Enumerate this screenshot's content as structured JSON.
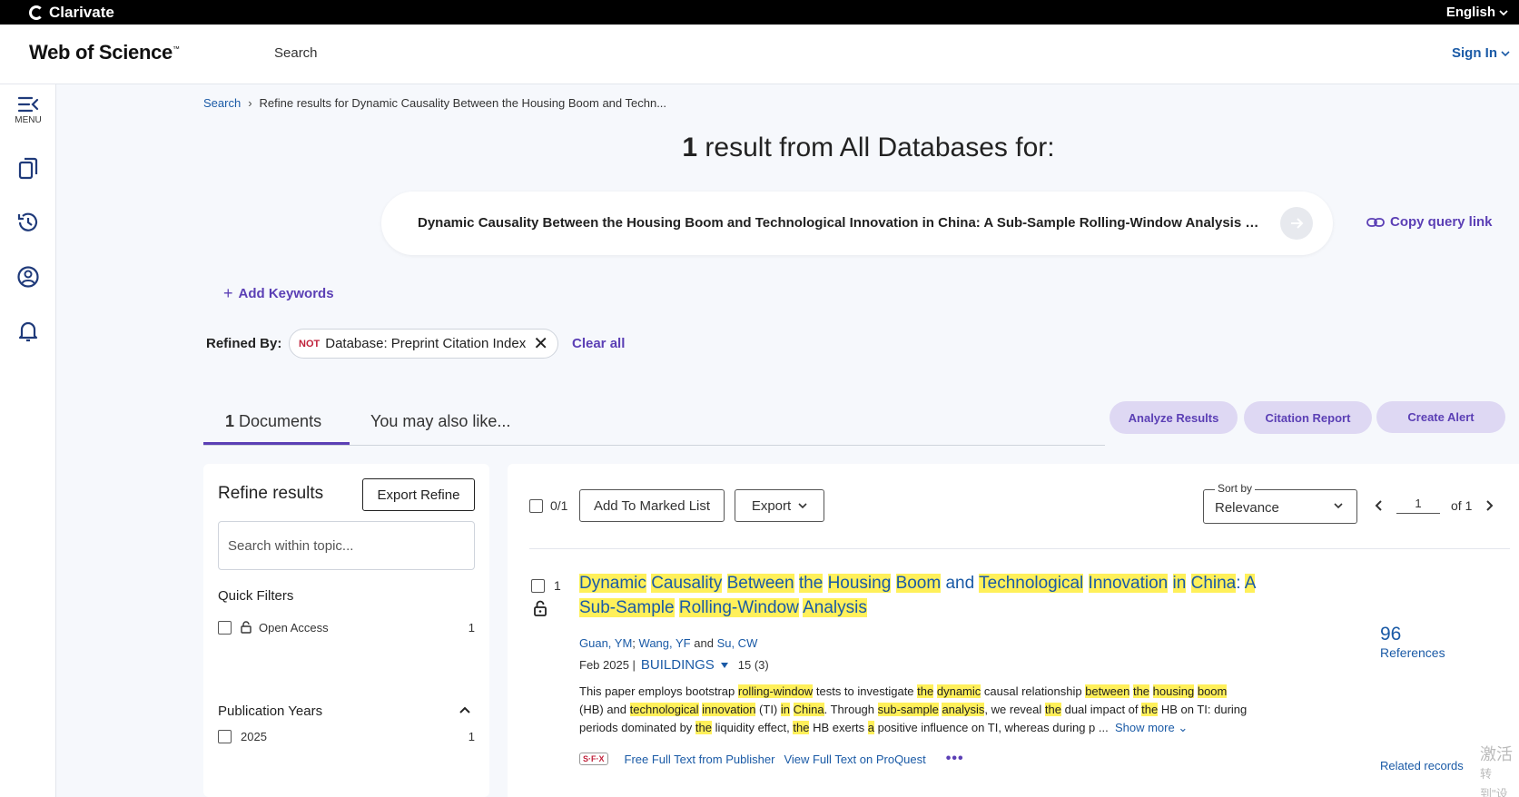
{
  "topbar": {
    "brand": "Clarivate",
    "language": "English"
  },
  "header": {
    "product": "Web of Science",
    "trademark": "™",
    "nav_search": "Search",
    "sign_in": "Sign In"
  },
  "rail": {
    "menu_label": "MENU"
  },
  "breadcrumb": {
    "root": "Search",
    "current": "Refine results for Dynamic Causality Between the Housing Boom and Techn..."
  },
  "headline": {
    "count": "1",
    "text": " result from All Databases for:"
  },
  "query": {
    "text": "Dynamic Causality Between the Housing Boom and Technological Innovation in China: A Sub-Sample Rolling-Window Analysis (To...",
    "copy_link": "Copy query link"
  },
  "add_keywords": "Add Keywords",
  "refined": {
    "label": "Refined By:",
    "not": "NOT",
    "filter": "Database: Preprint Citation Index",
    "clear_all": "Clear all"
  },
  "tabs": {
    "documents_count": "1",
    "documents_label": "Documents",
    "also_like": "You may also like..."
  },
  "actions": {
    "analyze": "Analyze Results",
    "citation_report": "Citation Report",
    "create_alert": "Create Alert"
  },
  "refine_panel": {
    "title": "Refine results",
    "export_refine": "Export Refine",
    "search_placeholder": "Search within topic...",
    "quick_filters": "Quick Filters",
    "open_access_label": "Open Access",
    "open_access_count": "1",
    "pub_years": "Publication Years",
    "year_2025_label": "2025",
    "year_2025_count": "1"
  },
  "toolbar": {
    "selected": "0/1",
    "add_marked": "Add To Marked List",
    "export": "Export",
    "sort_label": "Sort by",
    "sort_value": "Relevance",
    "page": "1",
    "of_pages": "of 1"
  },
  "record": {
    "index": "1",
    "authors": [
      "Guan, YM",
      "Wang, YF",
      "Su, CW"
    ],
    "and": "and",
    "date": "Feb 2025 |",
    "journal": "BUILDINGS",
    "volume": "15 (3)",
    "show_more": "Show more",
    "sfx": "S·F·X",
    "link_publisher": "Free Full Text from Publisher",
    "link_proquest": "View Full Text on ProQuest",
    "references_count": "96",
    "references_label": "References",
    "related": "Related records"
  },
  "watermark": {
    "line1": "激活",
    "line2": "转到\"设"
  },
  "colors": {
    "accent": "#5b3fb5",
    "link": "#1a5aa6",
    "highlight": "#fff05a",
    "pill_bg": "#ded8f3"
  }
}
